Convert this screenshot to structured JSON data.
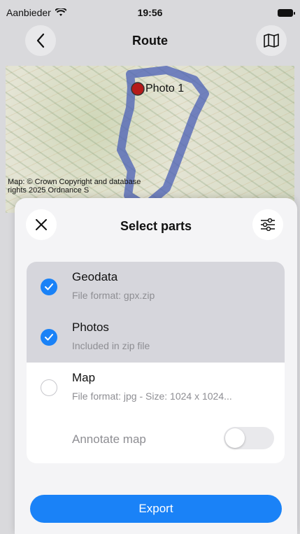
{
  "status": {
    "carrier": "Aanbieder",
    "time": "19:56"
  },
  "nav": {
    "title": "Route",
    "back_icon": "chevron-left-icon",
    "map_icon": "map-icon"
  },
  "map": {
    "photo_label": "Photo 1",
    "attribution": "Map: © Crown Copyright and database rights 2025 Ordnance S"
  },
  "sheet": {
    "title": "Select parts",
    "close_icon": "close-icon",
    "filter_icon": "sliders-icon",
    "items": [
      {
        "title": "Geodata",
        "subtitle": "File format: gpx.zip",
        "selected": true
      },
      {
        "title": "Photos",
        "subtitle": "Included in zip file",
        "selected": true
      },
      {
        "title": "Map",
        "subtitle": "File format: jpg - Size: 1024 x 1024...",
        "selected": false
      }
    ],
    "annotate_label": "Annotate map",
    "annotate_on": false,
    "export_label": "Export"
  },
  "colors": {
    "accent": "#1a82f7",
    "route": "#4a5fb5",
    "pin": "#b51a1a"
  }
}
